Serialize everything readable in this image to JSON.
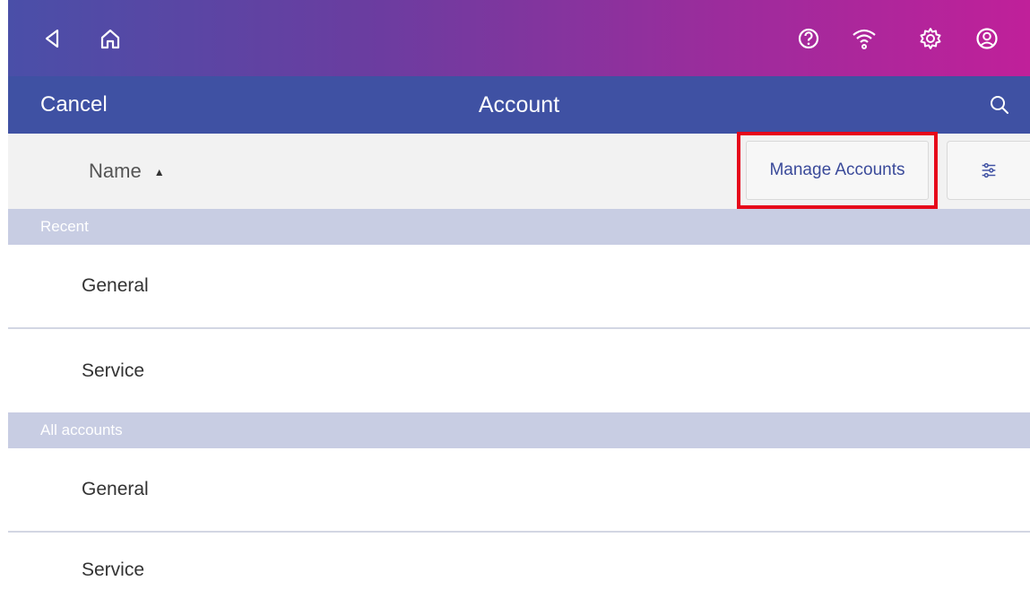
{
  "status_bar": {
    "icons": [
      "back-icon",
      "home-icon",
      "help-icon",
      "wifi-icon",
      "settings-icon",
      "account-icon"
    ]
  },
  "header": {
    "cancel_label": "Cancel",
    "title": "Account",
    "search_icon": "search-icon"
  },
  "sort_bar": {
    "column_label": "Name",
    "sort_direction": "ascending",
    "manage_accounts_label": "Manage Accounts",
    "filter_icon": "filter-icon"
  },
  "sections": [
    {
      "title": "Recent",
      "items": [
        "General",
        "Service"
      ]
    },
    {
      "title": "All accounts",
      "items": [
        "General",
        "Service"
      ]
    }
  ],
  "colors": {
    "gradient_start": "#4a4fa8",
    "gradient_end": "#c0209a",
    "title_bar": "#3f51a3",
    "section_header": "#c8cde3",
    "highlight": "#e6071a",
    "button_text": "#3a4a9a"
  }
}
